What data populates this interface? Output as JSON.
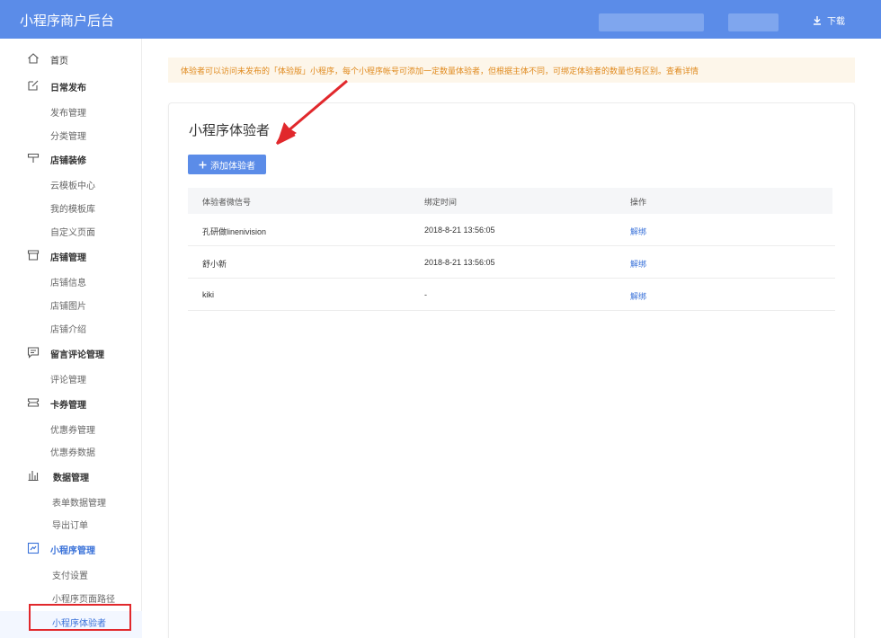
{
  "header": {
    "title": "小程序商户后台",
    "download_label": "下载"
  },
  "sidebar": {
    "home": "首页",
    "daily_publish": {
      "label": "日常发布",
      "items": [
        "发布管理",
        "分类管理"
      ]
    },
    "store_decor": {
      "label": "店铺装修",
      "items": [
        "云模板中心",
        "我的模板库",
        "自定义页面"
      ]
    },
    "store_manage": {
      "label": "店铺管理",
      "items": [
        "店铺信息",
        "店铺图片",
        "店铺介绍"
      ]
    },
    "comments": {
      "label": "留言评论管理",
      "items": [
        "评论管理"
      ]
    },
    "coupons": {
      "label": "卡券管理",
      "items": [
        "优惠券管理",
        "优惠券数据"
      ]
    },
    "data": {
      "label": "数据管理",
      "items": [
        "表单数据管理",
        "导出订单"
      ]
    },
    "miniprogram": {
      "label": "小程序管理",
      "items": [
        "支付设置",
        "小程序页面路径",
        "小程序体验者"
      ]
    }
  },
  "notice": {
    "text": "体验者可以访问未发布的「体验版」小程序，每个小程序帐号可添加一定数量体验者，但根据主体不同，可绑定体验者的数量也有区别。",
    "link": "查看详情"
  },
  "main": {
    "title": "小程序体验者",
    "add_button": "添加体验者",
    "columns": [
      "体验者微信号",
      "绑定时间",
      "操作"
    ],
    "rows": [
      {
        "wechat": "孔研做linenivision",
        "time": "2018-8-21 13:56:05",
        "action": "解绑"
      },
      {
        "wechat": "舒小新",
        "time": "2018-8-21 13:56:05",
        "action": "解绑"
      },
      {
        "wechat": "kiki",
        "time": "-",
        "action": "解绑"
      }
    ]
  },
  "colors": {
    "accent": "#5b8ce8",
    "link": "#3a72d9",
    "notice_bg": "#fdf6ea",
    "notice_text": "#e08a1e",
    "annotation_red": "#e1282c"
  }
}
